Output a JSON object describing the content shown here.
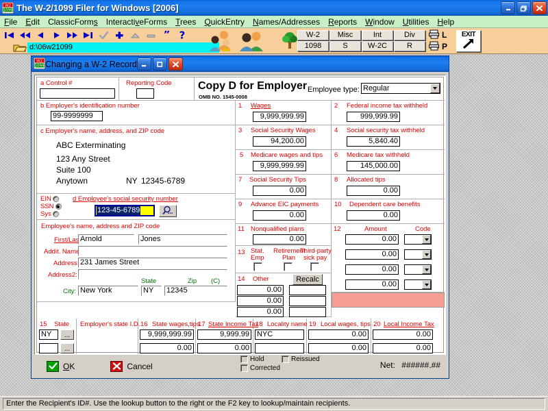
{
  "app": {
    "title": "The W-2/1099 Filer for Windows [2006]",
    "icon": "w2-1099-app-icon",
    "window_buttons": {
      "minimize": "minimize-icon",
      "restore": "restore-icon",
      "close": "close-icon"
    }
  },
  "menu": [
    {
      "label": "File",
      "accel": "F"
    },
    {
      "label": "Edit",
      "accel": "E"
    },
    {
      "label": "ClassicForms",
      "accel": "s"
    },
    {
      "label": "InteractiveForms",
      "accel": "v"
    },
    {
      "label": "Trees",
      "accel": "T"
    },
    {
      "label": "QuickEntry",
      "accel": "Q"
    },
    {
      "label": "Names/Addresses",
      "accel": "N"
    },
    {
      "label": "Reports",
      "accel": "R"
    },
    {
      "label": "Window",
      "accel": "W"
    },
    {
      "label": "Utilities",
      "accel": "U"
    },
    {
      "label": "Help",
      "accel": "H"
    }
  ],
  "toolbar": {
    "nav_icons": [
      "first-record-icon",
      "prev-page-icon",
      "prev-record-icon",
      "next-record-icon",
      "next-page-icon",
      "last-record-icon",
      "post-check-icon",
      "add-plus-icon",
      "up-triangle-icon",
      "delete-minus-icon",
      "quote-icon",
      "help-question-icon"
    ],
    "file_path": "d:\\06w21099",
    "folder_icon": "open-folder-icon",
    "people_icons": [
      "payers-group-icon",
      "recipients-group-icon"
    ],
    "tree_icon": "tree-icon",
    "form_buttons": [
      "W-2",
      "Misc",
      "Int",
      "Div",
      "1098",
      "S",
      "W-2C",
      "R"
    ],
    "printer_rows": [
      {
        "icon": "printer-icon",
        "label": "L"
      },
      {
        "icon": "printer-icon",
        "label": "P"
      }
    ],
    "exit": {
      "label": "EXIT",
      "icon": "exit-arrow-icon"
    }
  },
  "dialog": {
    "title": "Changing a W-2 Record",
    "icon": "w2-1099-app-icon",
    "window_buttons": {
      "minimize": "minimize-icon",
      "maximize": "maximize-icon",
      "close": "close-icon"
    },
    "header": {
      "control_label": "a  Control #",
      "control_value": "",
      "reporting_code_label": "Reporting Code",
      "reporting_code_value": "",
      "copy_title": "Copy D for Employer",
      "omb": "OMB NO. 1545-0008",
      "employee_type_label": "Employee type:",
      "employee_type_value": "Regular"
    },
    "employer": {
      "ein_label": "b  Employer's identification number",
      "ein_value": "99-9999999",
      "address_label": "c  Employer's name, address, and ZIP code",
      "name": "ABC Exterminating",
      "line1": "123 Any Street",
      "line2": "Suite 100",
      "city": "Anytown",
      "state": "NY",
      "zip": "12345-6789"
    },
    "idtype": {
      "options": [
        {
          "label": "EIN",
          "selected": false
        },
        {
          "label": "SSN",
          "selected": true
        },
        {
          "label": "Sys",
          "selected": false
        }
      ],
      "ssn_label": "d  Employee's social security number",
      "ssn_value": "123-45-6789",
      "lookup_icon": "magnifier-lookup-icon"
    },
    "employee": {
      "section_label": "Employee's name, address and ZIP code",
      "firstlast_label": "First/Last:",
      "first": "Arnold",
      "last": "Jones",
      "addit_name_label": "Addit. Name:",
      "addit_name": "",
      "address_label": "Address:",
      "address": "231 James Street",
      "address2_label": "Address2:",
      "address2": "",
      "city_label": "City:",
      "city": "New York",
      "state_label": "State",
      "state": "NY",
      "zip_label": "Zip",
      "zip_c_label": "(C)",
      "zip": "12345"
    },
    "boxes": [
      {
        "num": "1",
        "label": "Wages",
        "value": "9,999,999.99",
        "underline": true
      },
      {
        "num": "2",
        "label": "Federal income tax withheld",
        "value": "999,999.99"
      },
      {
        "num": "3",
        "label": "Social Security Wages",
        "value": "94,200.00"
      },
      {
        "num": "4",
        "label": "Social security tax withheld",
        "value": "5,840.40"
      },
      {
        "num": "5",
        "label": "Medicare wages and tips",
        "value": "9,999,999.99"
      },
      {
        "num": "6",
        "label": "Medicare tax withheld",
        "value": "145,000.00"
      },
      {
        "num": "7",
        "label": "Social Security Tips",
        "value": "0.00"
      },
      {
        "num": "8",
        "label": "Allocated tips",
        "value": "0.00"
      },
      {
        "num": "9",
        "label": "Advance EIC payments",
        "value": "0.00"
      },
      {
        "num": "10",
        "label": "Dependent care benefits",
        "value": "0.00"
      },
      {
        "num": "11",
        "label": "Nonqualified plans",
        "value": "0.00"
      }
    ],
    "box12": {
      "num": "12",
      "amount_label": "Amount",
      "code_label": "Code",
      "rows": [
        {
          "amount": "0.00",
          "code": ""
        },
        {
          "amount": "0.00",
          "code": ""
        },
        {
          "amount": "0.00",
          "code": ""
        },
        {
          "amount": "0.00",
          "code": ""
        }
      ]
    },
    "box13": {
      "num": "13",
      "items": [
        {
          "label_line1": "Stat.",
          "label_line2": "Emp",
          "checked": false
        },
        {
          "label_line1": "Retirement",
          "label_line2": "Plan",
          "checked": false
        },
        {
          "label_line1": "Third-party",
          "label_line2": "sick pay",
          "checked": false
        }
      ]
    },
    "box14": {
      "num": "14",
      "label": "Other",
      "recalc_label": "Recalc",
      "rows": [
        {
          "amount": "0.00",
          "desc": ""
        },
        {
          "amount": "0.00",
          "desc": ""
        },
        {
          "amount": "0.00",
          "desc": ""
        }
      ]
    },
    "state_section": {
      "headers": [
        {
          "num": "15",
          "label": "State"
        },
        {
          "num": "",
          "label": "Employer's state I.D."
        },
        {
          "num": "16",
          "label": "State wages,tips"
        },
        {
          "num": "17",
          "label": "State Income Tax",
          "underline": true
        },
        {
          "num": "18",
          "label": "Locality name"
        },
        {
          "num": "19",
          "label": "Local wages, tips"
        },
        {
          "num": "20",
          "label": "Local Income Tax",
          "underline": true
        }
      ],
      "rows": [
        {
          "state": "NY",
          "state_id": "",
          "state_wages": "9,999,999.99",
          "state_tax": "9,999.99",
          "locality": "NYC",
          "local_wages": "0.00",
          "local_tax": "0.00"
        },
        {
          "state": "",
          "state_id": "",
          "state_wages": "0.00",
          "state_tax": "0.00",
          "locality": "",
          "local_wages": "0.00",
          "local_tax": "0.00"
        }
      ],
      "lookup_button_label": "..."
    },
    "footer": {
      "ok_label": "OK",
      "ok_accel": "O",
      "ok_icon": "check-icon",
      "cancel_label": "Cancel",
      "cancel_icon": "x-icon",
      "checkboxes": [
        {
          "label": "Hold",
          "checked": false
        },
        {
          "label": "Reissued",
          "checked": false
        },
        {
          "label": "Corrected",
          "checked": false
        }
      ],
      "net_label": "Net:",
      "net_value": "######.##"
    }
  },
  "status_bar": {
    "message": "Enter the Recipient's ID#.  Use the lookup button to the right or the F2 key to lookup/maintain recipients."
  },
  "colors": {
    "title_blue": "#1f7ff0",
    "menu_green": "#c7f0c7",
    "toolbar_peach": "#f8cf9a",
    "label_red": "#e00000",
    "label_green": "#007000",
    "focus_yellow": "#ffff00",
    "pink_block": "#f79c92",
    "path_cyan": "#00f2f2"
  }
}
